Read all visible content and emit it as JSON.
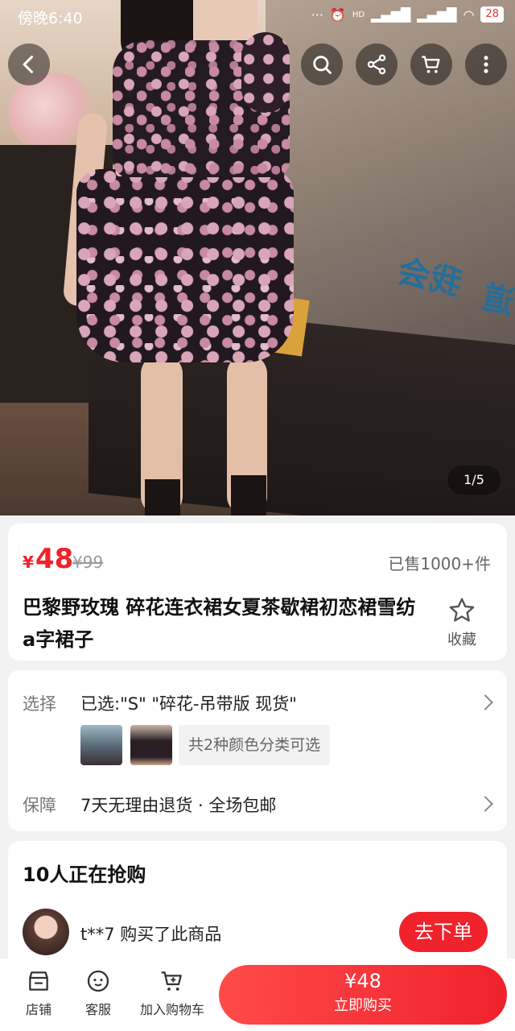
{
  "status_bar": {
    "time": "傍晚6:40",
    "battery": "28",
    "hd": "HD"
  },
  "gallery": {
    "counter": "1/5",
    "screen_text_1": "我会",
    "screen_text_2": "道"
  },
  "product": {
    "currency": "¥",
    "price": "48",
    "original_price": "¥99",
    "sold": "已售1000+件",
    "title": "巴黎野玫瑰 碎花连衣裙女夏茶歇裙初恋裙雪纺a字裙子",
    "favorite_label": "收藏"
  },
  "options": {
    "select_label": "选择",
    "select_value": "已选:\"S\"  \"碎花-吊带版 现货\"",
    "color_note": "共2种颜色分类可选",
    "guarantee_label": "保障",
    "guarantee_value": "7天无理由退货 · 全场包邮"
  },
  "buying": {
    "title": "10人正在抢购",
    "buyer_text": "t**7 购买了此商品",
    "order_button": "去下单"
  },
  "bottom_bar": {
    "store": "店铺",
    "service": "客服",
    "cart": "加入购物车",
    "buy_price": "¥48",
    "buy_label": "立即购买"
  },
  "colors": {
    "accent": "#f0222c",
    "background": "#f2f2f2"
  }
}
